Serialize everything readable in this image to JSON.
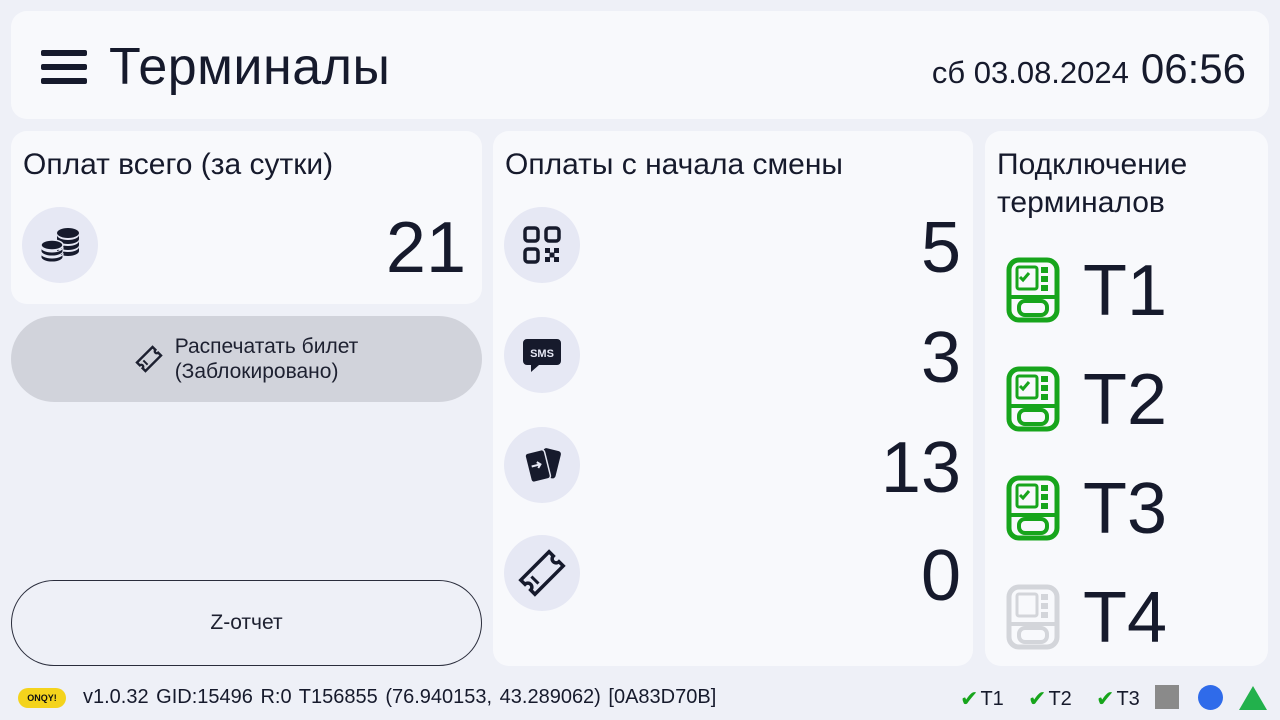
{
  "header": {
    "title": "Терминалы",
    "date": "сб 03.08.2024",
    "time": "06:56"
  },
  "total": {
    "title": "Оплат всего (за сутки)",
    "value": "21",
    "icon": "coins-icon"
  },
  "print_button": {
    "line1": "Распечатать билет",
    "line2": "(Заблокировано)",
    "icon": "ticket-icon"
  },
  "z_report_button": "Z-отчет",
  "shift": {
    "title": "Оплаты с начала смены",
    "items": [
      {
        "icon": "qr-code-icon",
        "value": "5"
      },
      {
        "icon": "sms-icon",
        "value": "3"
      },
      {
        "icon": "cards-icon",
        "value": "13"
      },
      {
        "icon": "ticket-icon",
        "value": "0"
      }
    ]
  },
  "connection": {
    "title_line1": "Подключение",
    "title_line2": "терминалов",
    "terminals": [
      {
        "label": "T1",
        "status": "connected"
      },
      {
        "label": "T2",
        "status": "connected"
      },
      {
        "label": "T3",
        "status": "connected"
      },
      {
        "label": "T4",
        "status": "disconnected"
      }
    ]
  },
  "statusbar": {
    "logo": "ONQY!",
    "version": "v1.0.32",
    "gid": "GID:15496",
    "r": "R:0",
    "tid": "T156855",
    "coords": "(76.940153, 43.289062)",
    "hex": "[0A83D70B]",
    "term_status": [
      {
        "label": "T1"
      },
      {
        "label": "T2"
      },
      {
        "label": "T3"
      }
    ]
  },
  "colors": {
    "background": "#eef0f7",
    "card": "#f8f9fc",
    "connected": "#17a51c",
    "disconnected": "#d3d5da",
    "indicator_square": "#8a8a8a",
    "indicator_circle": "#2f6bea",
    "indicator_triangle": "#22b14c",
    "logo": "#f4d31c"
  }
}
